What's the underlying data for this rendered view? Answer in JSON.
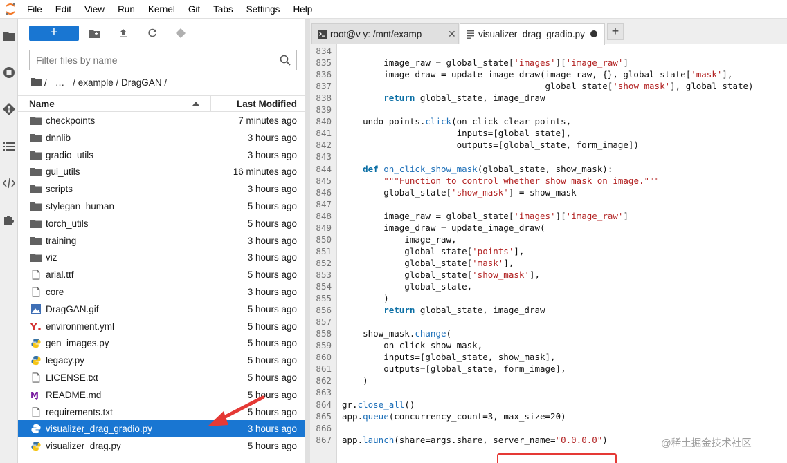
{
  "menubar": {
    "items": [
      "File",
      "Edit",
      "View",
      "Run",
      "Kernel",
      "Git",
      "Tabs",
      "Settings",
      "Help"
    ]
  },
  "filebrowser": {
    "new_button_label": "+",
    "filter_placeholder": "Filter files by name",
    "breadcrumbs": [
      "/",
      "…",
      "/ example / DragGAN /"
    ],
    "header_name": "Name",
    "header_modified": "Last Modified",
    "files": [
      {
        "name": "checkpoints",
        "modified": "7 minutes ago",
        "type": "folder"
      },
      {
        "name": "dnnlib",
        "modified": "3 hours ago",
        "type": "folder"
      },
      {
        "name": "gradio_utils",
        "modified": "3 hours ago",
        "type": "folder"
      },
      {
        "name": "gui_utils",
        "modified": "16 minutes ago",
        "type": "folder"
      },
      {
        "name": "scripts",
        "modified": "3 hours ago",
        "type": "folder"
      },
      {
        "name": "stylegan_human",
        "modified": "5 hours ago",
        "type": "folder"
      },
      {
        "name": "torch_utils",
        "modified": "5 hours ago",
        "type": "folder"
      },
      {
        "name": "training",
        "modified": "3 hours ago",
        "type": "folder"
      },
      {
        "name": "viz",
        "modified": "3 hours ago",
        "type": "folder"
      },
      {
        "name": "arial.ttf",
        "modified": "5 hours ago",
        "type": "file"
      },
      {
        "name": "core",
        "modified": "3 hours ago",
        "type": "file"
      },
      {
        "name": "DragGAN.gif",
        "modified": "5 hours ago",
        "type": "image"
      },
      {
        "name": "environment.yml",
        "modified": "5 hours ago",
        "type": "yaml"
      },
      {
        "name": "gen_images.py",
        "modified": "5 hours ago",
        "type": "python"
      },
      {
        "name": "legacy.py",
        "modified": "5 hours ago",
        "type": "python"
      },
      {
        "name": "LICENSE.txt",
        "modified": "5 hours ago",
        "type": "file"
      },
      {
        "name": "README.md",
        "modified": "5 hours ago",
        "type": "markdown"
      },
      {
        "name": "requirements.txt",
        "modified": "5 hours ago",
        "type": "file"
      },
      {
        "name": "visualizer_drag_gradio.py",
        "modified": "3 hours ago",
        "type": "python",
        "selected": true
      },
      {
        "name": "visualizer_drag.py",
        "modified": "5 hours ago",
        "type": "python"
      }
    ]
  },
  "tabs": {
    "terminal_label": "root@v        y: /mnt/examp",
    "editor_label": "visualizer_drag_gradio.py",
    "add_label": "+"
  },
  "code": {
    "lines": [
      {
        "n": "834",
        "t": ""
      },
      {
        "n": "835",
        "t": "        image_raw = global_state['images']['image_raw']"
      },
      {
        "n": "836",
        "t": "        image_draw = update_image_draw(image_raw, {}, global_state['mask'],"
      },
      {
        "n": "837",
        "t": "                                       global_state['show_mask'], global_state)"
      },
      {
        "n": "838",
        "t": "        return global_state, image_draw"
      },
      {
        "n": "839",
        "t": ""
      },
      {
        "n": "840",
        "t": "    undo_points.click(on_click_clear_points,"
      },
      {
        "n": "841",
        "t": "                      inputs=[global_state],"
      },
      {
        "n": "842",
        "t": "                      outputs=[global_state, form_image])"
      },
      {
        "n": "843",
        "t": ""
      },
      {
        "n": "844",
        "t": "    def on_click_show_mask(global_state, show_mask):"
      },
      {
        "n": "845",
        "t": "        \"\"\"Function to control whether show mask on image.\"\"\""
      },
      {
        "n": "846",
        "t": "        global_state['show_mask'] = show_mask"
      },
      {
        "n": "847",
        "t": ""
      },
      {
        "n": "848",
        "t": "        image_raw = global_state['images']['image_raw']"
      },
      {
        "n": "849",
        "t": "        image_draw = update_image_draw("
      },
      {
        "n": "850",
        "t": "            image_raw,"
      },
      {
        "n": "851",
        "t": "            global_state['points'],"
      },
      {
        "n": "852",
        "t": "            global_state['mask'],"
      },
      {
        "n": "853",
        "t": "            global_state['show_mask'],"
      },
      {
        "n": "854",
        "t": "            global_state,"
      },
      {
        "n": "855",
        "t": "        )"
      },
      {
        "n": "856",
        "t": "        return global_state, image_draw"
      },
      {
        "n": "857",
        "t": ""
      },
      {
        "n": "858",
        "t": "    show_mask.change("
      },
      {
        "n": "859",
        "t": "        on_click_show_mask,"
      },
      {
        "n": "860",
        "t": "        inputs=[global_state, show_mask],"
      },
      {
        "n": "861",
        "t": "        outputs=[global_state, form_image],"
      },
      {
        "n": "862",
        "t": "    )"
      },
      {
        "n": "863",
        "t": ""
      },
      {
        "n": "864",
        "t": "gr.close_all()"
      },
      {
        "n": "865",
        "t": "app.queue(concurrency_count=3, max_size=20)"
      },
      {
        "n": "866",
        "t": ""
      },
      {
        "n": "867",
        "t": "app.launch(share=args.share, server_name=\"0.0.0.0\")"
      }
    ]
  },
  "watermark": "@稀土掘金技术社区",
  "colors": {
    "accent": "#1976d2",
    "annotation": "#e53935"
  }
}
